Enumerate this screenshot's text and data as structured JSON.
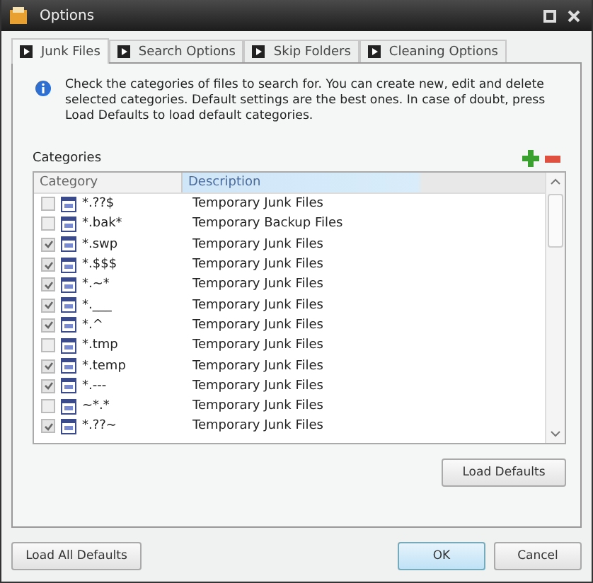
{
  "window": {
    "title": "Options"
  },
  "tabs": [
    {
      "label": "Junk Files",
      "selected": true
    },
    {
      "label": "Search Options",
      "selected": false
    },
    {
      "label": "Skip Folders",
      "selected": false
    },
    {
      "label": "Cleaning Options",
      "selected": false
    }
  ],
  "info": "Check the categories of files to search for. You can create new, edit and delete selected categories. Default settings are the best ones. In case of doubt, press Load Defaults to load default categories.",
  "categories": {
    "label": "Categories",
    "columns": [
      "Category",
      "Description"
    ],
    "rows": [
      {
        "category": "*.??$",
        "description": "Temporary Junk Files",
        "checked": false
      },
      {
        "category": "*.bak*",
        "description": "Temporary Backup Files",
        "checked": false
      },
      {
        "category": "*.swp",
        "description": "Temporary Junk Files",
        "checked": true
      },
      {
        "category": "*.$$$",
        "description": "Temporary Junk Files",
        "checked": true
      },
      {
        "category": "*.~*",
        "description": "Temporary Junk Files",
        "checked": true
      },
      {
        "category": "*.___",
        "description": "Temporary Junk Files",
        "checked": true
      },
      {
        "category": "*.^",
        "description": "Temporary Junk Files",
        "checked": true
      },
      {
        "category": "*.tmp",
        "description": "Temporary Junk Files",
        "checked": false
      },
      {
        "category": "*.temp",
        "description": "Temporary Junk Files",
        "checked": true
      },
      {
        "category": "*.---",
        "description": "Temporary Junk Files",
        "checked": true
      },
      {
        "category": "~*.*",
        "description": "Temporary Junk Files",
        "checked": false
      },
      {
        "category": "*.??~",
        "description": "Temporary Junk Files",
        "checked": true
      }
    ]
  },
  "load_defaults": "Load Defaults",
  "buttons": {
    "load_all": "Load All Defaults",
    "ok": "OK",
    "cancel": "Cancel"
  }
}
